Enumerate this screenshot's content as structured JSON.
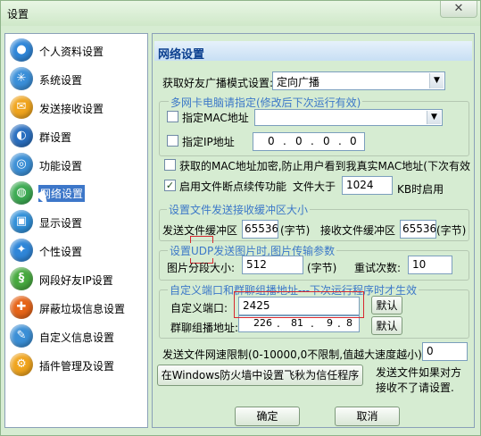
{
  "window": {
    "title": "设置",
    "close_label": "✕"
  },
  "sidebar": {
    "items": [
      {
        "label": "个人资料设置",
        "icon": "user-profile-icon",
        "color": "#2f86d8",
        "glyph": "●"
      },
      {
        "label": "系统设置",
        "icon": "system-gear-icon",
        "color": "#3a8fd9",
        "glyph": "✳"
      },
      {
        "label": "发送接收设置",
        "icon": "send-receive-icon",
        "color": "#f0a41c",
        "glyph": "✉"
      },
      {
        "label": "群设置",
        "icon": "group-globe-icon",
        "color": "#2a6fc0",
        "glyph": "◐"
      },
      {
        "label": "功能设置",
        "icon": "function-target-icon",
        "color": "#3b8fd6",
        "glyph": "◎"
      },
      {
        "label": "网络设置",
        "icon": "network-globe-icon",
        "color": "#3cab52",
        "glyph": "◍"
      },
      {
        "label": "显示设置",
        "icon": "display-icon",
        "color": "#2f8fd8",
        "glyph": "▣"
      },
      {
        "label": "个性设置",
        "icon": "personality-star-icon",
        "color": "#2f86d8",
        "glyph": "✦"
      },
      {
        "label": "网段好友IP设置",
        "icon": "ip-segment-icon",
        "color": "#47a93f",
        "glyph": "§"
      },
      {
        "label": "屏蔽垃圾信息设置",
        "icon": "block-spam-icon",
        "color": "#e66418",
        "glyph": "✚"
      },
      {
        "label": "自定义信息设置",
        "icon": "custom-info-icon",
        "color": "#3b8fd6",
        "glyph": "✎"
      },
      {
        "label": "插件管理及设置",
        "icon": "plugin-icon",
        "color": "#f0a41c",
        "glyph": "⚙"
      }
    ],
    "active_index": 5
  },
  "panel": {
    "title": "网络设置",
    "friend_mode": {
      "label": "获取好友广播模式设置:",
      "value": "定向广播"
    },
    "multi_nic": {
      "title": "多网卡电脑请指定(修改后下次运行有效)",
      "mac_label": "指定MAC地址",
      "mac_value": "",
      "ip_label": "指定IP地址",
      "ip_octets": [
        "0",
        "0",
        "0",
        "0"
      ]
    },
    "mac_encrypt_label": "获取的MAC地址加密,防止用户看到我真实MAC地址(下次有效",
    "resume": {
      "label": "启用文件断点续传功能",
      "size_label": "文件大于",
      "size_value": "1024",
      "unit_label": "KB时启用"
    },
    "buffer": {
      "title": "设置文件发送接收缓冲区大小",
      "send_label": "发送文件缓冲区",
      "send_value": "65536",
      "send_unit": "(字节)",
      "recv_label": "接收文件缓冲区",
      "recv_value": "65536",
      "recv_unit": "(字节)"
    },
    "udp": {
      "title": "设置UDP发送图片时,图片传输参数",
      "split_label": "图片分段大小:",
      "split_value": "512",
      "split_unit": "(字节)",
      "retry_label": "重试次数:",
      "retry_value": "10"
    },
    "custom_port": {
      "title": "自定义端口和群聊组播地址---下次运行程序时才生效",
      "port_label": "自定义端口:",
      "port_value": "2425",
      "port_default": "默认",
      "multicast_label": "群聊组播地址:",
      "multicast_octets": [
        "226",
        "81",
        "9",
        "8"
      ],
      "multicast_default": "默认"
    },
    "speed": {
      "label": "发送文件网速限制(0-10000,0不限制,值越大速度越小)",
      "value": "0"
    },
    "firewall": {
      "button_label": "在Windows防火墙中设置飞秋为信任程序",
      "note_line1": "发送文件如果对方",
      "note_line2": "接收不了请设置."
    },
    "ok_label": "确定",
    "cancel_label": "取消"
  }
}
